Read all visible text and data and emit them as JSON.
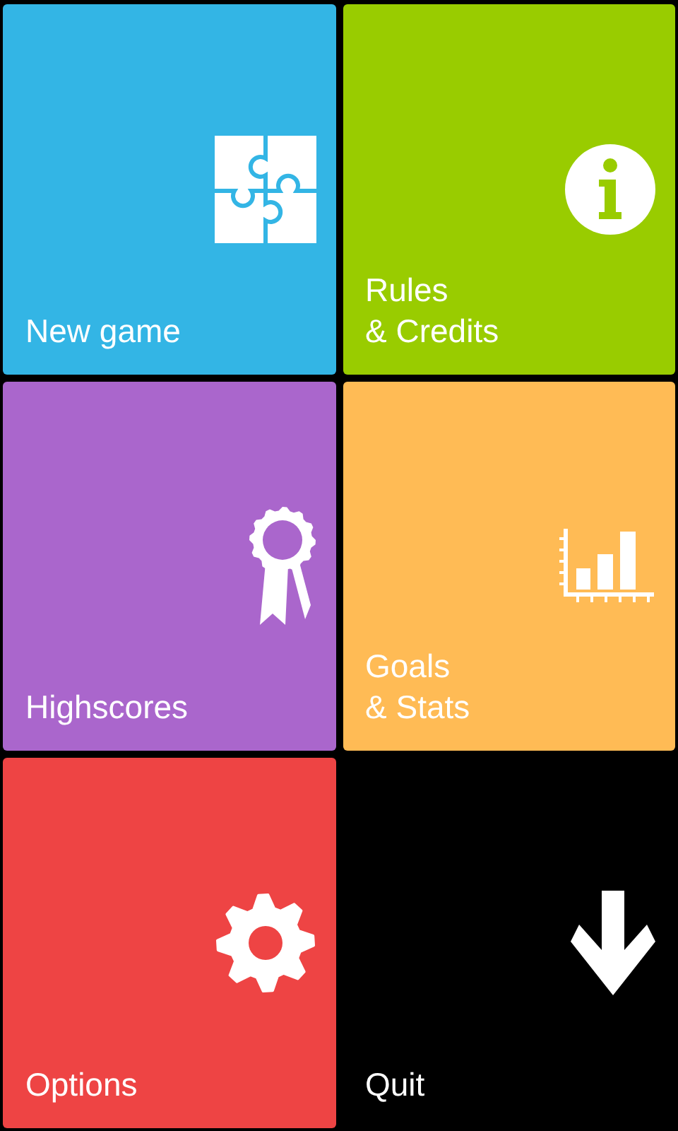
{
  "rows": [
    {
      "tiles": [
        {
          "kind": "puzzle",
          "label": "New game",
          "color": "#33b5e5"
        },
        {
          "kind": "info",
          "label": "Rules\n& Credits",
          "color": "#99cc00"
        }
      ]
    },
    {
      "tiles": [
        {
          "kind": "ribbon",
          "label": "Highscores",
          "color": "#aa66cc"
        },
        {
          "kind": "chart",
          "label": "Goals\n& Stats",
          "color": "#ffbb55"
        }
      ]
    },
    {
      "tiles": [
        {
          "kind": "gear",
          "label": "Options",
          "color": "#ee4444"
        },
        {
          "kind": "arrow",
          "label": "Quit",
          "color": "#000000"
        }
      ]
    }
  ]
}
